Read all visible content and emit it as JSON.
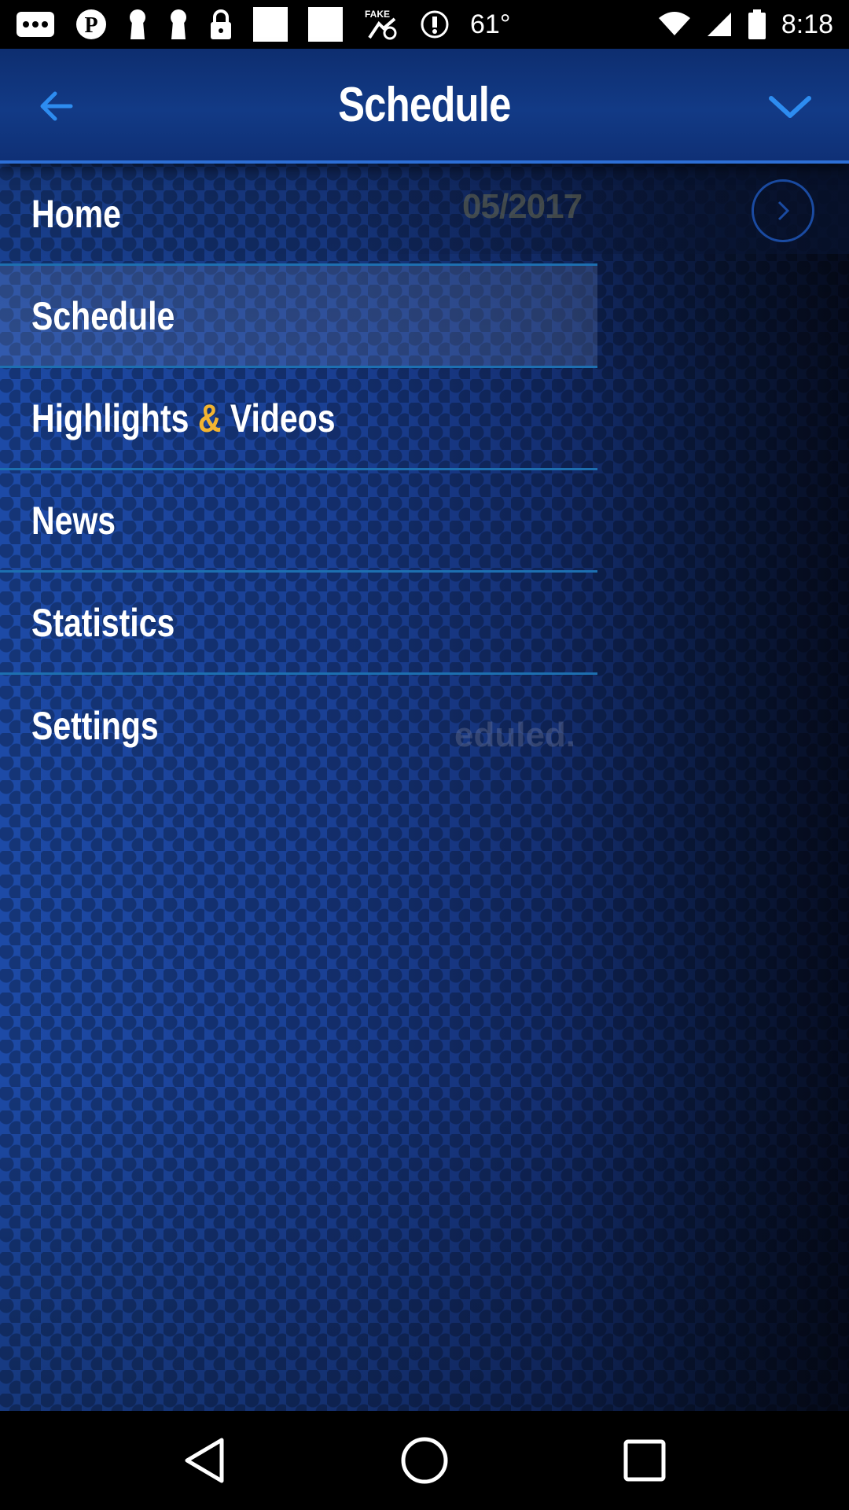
{
  "status_bar": {
    "temperature": "61°",
    "time": "8:18",
    "icons": [
      "more-notifications-icon",
      "pinterest-icon",
      "keyhole-icon",
      "keyhole-icon",
      "lock-icon",
      "blank-square-icon",
      "blank-square-icon",
      "fake-gps-icon",
      "info-icon",
      "wifi-icon",
      "signal-icon",
      "battery-icon"
    ]
  },
  "app_bar": {
    "title": "Schedule",
    "back_icon": "arrow-back-icon",
    "menu_icon": "chevron-down-icon",
    "accent": "#2d8cf0"
  },
  "background": {
    "date_text": "05/2017",
    "partial_text": "eduled."
  },
  "drawer": {
    "items": [
      {
        "label": "Home"
      },
      {
        "label": "Schedule",
        "active": true
      },
      {
        "label_part1": "Highlights",
        "label_amp": "&",
        "label_part2": "Videos"
      },
      {
        "label": "News"
      },
      {
        "label": "Statistics"
      },
      {
        "label": "Settings"
      }
    ],
    "amp_color": "#f2b431"
  },
  "nav_bar": {
    "icons": [
      "back-triangle-icon",
      "home-circle-icon",
      "recents-square-icon"
    ]
  }
}
